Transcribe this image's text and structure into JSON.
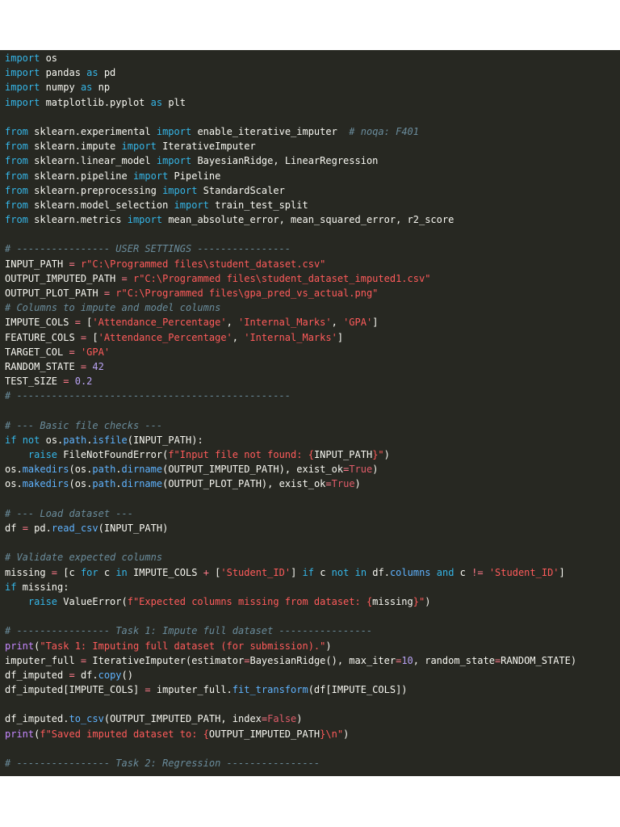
{
  "code_lines": [
    [
      {
        "t": "import",
        "c": "kw"
      },
      {
        "t": " os"
      }
    ],
    [
      {
        "t": "import",
        "c": "kw"
      },
      {
        "t": " pandas "
      },
      {
        "t": "as",
        "c": "kw"
      },
      {
        "t": " pd"
      }
    ],
    [
      {
        "t": "import",
        "c": "kw"
      },
      {
        "t": " numpy "
      },
      {
        "t": "as",
        "c": "kw"
      },
      {
        "t": " np"
      }
    ],
    [
      {
        "t": "import",
        "c": "kw"
      },
      {
        "t": " matplotlib.pyplot "
      },
      {
        "t": "as",
        "c": "kw"
      },
      {
        "t": " plt"
      }
    ],
    [],
    [
      {
        "t": "from",
        "c": "kw"
      },
      {
        "t": " sklearn.experimental "
      },
      {
        "t": "import",
        "c": "kw"
      },
      {
        "t": " enable_iterative_imputer  "
      },
      {
        "t": "# noqa: F401",
        "c": "cmt"
      }
    ],
    [
      {
        "t": "from",
        "c": "kw"
      },
      {
        "t": " sklearn.impute "
      },
      {
        "t": "import",
        "c": "kw"
      },
      {
        "t": " IterativeImputer"
      }
    ],
    [
      {
        "t": "from",
        "c": "kw"
      },
      {
        "t": " sklearn.linear_model "
      },
      {
        "t": "import",
        "c": "kw"
      },
      {
        "t": " BayesianRidge, LinearRegression"
      }
    ],
    [
      {
        "t": "from",
        "c": "kw"
      },
      {
        "t": " sklearn.pipeline "
      },
      {
        "t": "import",
        "c": "kw"
      },
      {
        "t": " Pipeline"
      }
    ],
    [
      {
        "t": "from",
        "c": "kw"
      },
      {
        "t": " sklearn.preprocessing "
      },
      {
        "t": "import",
        "c": "kw"
      },
      {
        "t": " StandardScaler"
      }
    ],
    [
      {
        "t": "from",
        "c": "kw"
      },
      {
        "t": " sklearn.model_selection "
      },
      {
        "t": "import",
        "c": "kw"
      },
      {
        "t": " train_test_split"
      }
    ],
    [
      {
        "t": "from",
        "c": "kw"
      },
      {
        "t": " sklearn.metrics "
      },
      {
        "t": "import",
        "c": "kw"
      },
      {
        "t": " mean_absolute_error, mean_squared_error, r2_score"
      }
    ],
    [],
    [
      {
        "t": "# ---------------- USER SETTINGS ----------------",
        "c": "cmt"
      }
    ],
    [
      {
        "t": "INPUT_PATH "
      },
      {
        "t": "=",
        "c": "op"
      },
      {
        "t": " "
      },
      {
        "t": "r\"C:\\Programmed files\\student_dataset.csv\"",
        "c": "str"
      }
    ],
    [
      {
        "t": "OUTPUT_IMPUTED_PATH "
      },
      {
        "t": "=",
        "c": "op"
      },
      {
        "t": " "
      },
      {
        "t": "r\"C:\\Programmed files\\student_dataset_imputed1.csv\"",
        "c": "str"
      }
    ],
    [
      {
        "t": "OUTPUT_PLOT_PATH "
      },
      {
        "t": "=",
        "c": "op"
      },
      {
        "t": " "
      },
      {
        "t": "r\"C:\\Programmed files\\gpa_pred_vs_actual.png\"",
        "c": "str"
      }
    ],
    [
      {
        "t": "# Columns to impute and model columns",
        "c": "cmt"
      }
    ],
    [
      {
        "t": "IMPUTE_COLS "
      },
      {
        "t": "=",
        "c": "op"
      },
      {
        "t": " ["
      },
      {
        "t": "'Attendance_Percentage'",
        "c": "str"
      },
      {
        "t": ", "
      },
      {
        "t": "'Internal_Marks'",
        "c": "str"
      },
      {
        "t": ", "
      },
      {
        "t": "'GPA'",
        "c": "str"
      },
      {
        "t": "]"
      }
    ],
    [
      {
        "t": "FEATURE_COLS "
      },
      {
        "t": "=",
        "c": "op"
      },
      {
        "t": " ["
      },
      {
        "t": "'Attendance_Percentage'",
        "c": "str"
      },
      {
        "t": ", "
      },
      {
        "t": "'Internal_Marks'",
        "c": "str"
      },
      {
        "t": "]"
      }
    ],
    [
      {
        "t": "TARGET_COL "
      },
      {
        "t": "=",
        "c": "op"
      },
      {
        "t": " "
      },
      {
        "t": "'GPA'",
        "c": "str"
      }
    ],
    [
      {
        "t": "RANDOM_STATE "
      },
      {
        "t": "=",
        "c": "op"
      },
      {
        "t": " "
      },
      {
        "t": "42",
        "c": "num"
      }
    ],
    [
      {
        "t": "TEST_SIZE "
      },
      {
        "t": "=",
        "c": "op"
      },
      {
        "t": " "
      },
      {
        "t": "0.2",
        "c": "num"
      }
    ],
    [
      {
        "t": "# -----------------------------------------------",
        "c": "cmt"
      }
    ],
    [],
    [
      {
        "t": "# --- Basic file checks ---",
        "c": "cmt"
      }
    ],
    [
      {
        "t": "if",
        "c": "kw"
      },
      {
        "t": " "
      },
      {
        "t": "not",
        "c": "kw"
      },
      {
        "t": " os."
      },
      {
        "t": "path",
        "c": "fn"
      },
      {
        "t": "."
      },
      {
        "t": "isfile",
        "c": "fn"
      },
      {
        "t": "(INPUT_PATH):"
      }
    ],
    [
      {
        "t": "    "
      },
      {
        "t": "raise",
        "c": "kw"
      },
      {
        "t": " FileNotFoundError("
      },
      {
        "t": "f\"Input file not found: {",
        "c": "str"
      },
      {
        "t": "INPUT_PATH"
      },
      {
        "t": "}\"",
        "c": "str"
      },
      {
        "t": ")"
      }
    ],
    [
      {
        "t": "os."
      },
      {
        "t": "makedirs",
        "c": "fn"
      },
      {
        "t": "(os."
      },
      {
        "t": "path",
        "c": "fn"
      },
      {
        "t": "."
      },
      {
        "t": "dirname",
        "c": "fn"
      },
      {
        "t": "(OUTPUT_IMPUTED_PATH), exist_ok"
      },
      {
        "t": "=",
        "c": "op"
      },
      {
        "t": "True",
        "c": "cst"
      },
      {
        "t": ")"
      }
    ],
    [
      {
        "t": "os."
      },
      {
        "t": "makedirs",
        "c": "fn"
      },
      {
        "t": "(os."
      },
      {
        "t": "path",
        "c": "fn"
      },
      {
        "t": "."
      },
      {
        "t": "dirname",
        "c": "fn"
      },
      {
        "t": "(OUTPUT_PLOT_PATH), exist_ok"
      },
      {
        "t": "=",
        "c": "op"
      },
      {
        "t": "True",
        "c": "cst"
      },
      {
        "t": ")"
      }
    ],
    [],
    [
      {
        "t": "# --- Load dataset ---",
        "c": "cmt"
      }
    ],
    [
      {
        "t": "df "
      },
      {
        "t": "=",
        "c": "op"
      },
      {
        "t": " pd."
      },
      {
        "t": "read_csv",
        "c": "fn"
      },
      {
        "t": "(INPUT_PATH)"
      }
    ],
    [],
    [
      {
        "t": "# Validate expected columns",
        "c": "cmt"
      }
    ],
    [
      {
        "t": "missing "
      },
      {
        "t": "=",
        "c": "op"
      },
      {
        "t": " [c "
      },
      {
        "t": "for",
        "c": "kw"
      },
      {
        "t": " c "
      },
      {
        "t": "in",
        "c": "kw"
      },
      {
        "t": " IMPUTE_COLS "
      },
      {
        "t": "+",
        "c": "op"
      },
      {
        "t": " ["
      },
      {
        "t": "'Student_ID'",
        "c": "str"
      },
      {
        "t": "] "
      },
      {
        "t": "if",
        "c": "kw"
      },
      {
        "t": " c "
      },
      {
        "t": "not",
        "c": "kw"
      },
      {
        "t": " "
      },
      {
        "t": "in",
        "c": "kw"
      },
      {
        "t": " df."
      },
      {
        "t": "columns",
        "c": "fn"
      },
      {
        "t": " "
      },
      {
        "t": "and",
        "c": "kw"
      },
      {
        "t": " c "
      },
      {
        "t": "!=",
        "c": "op"
      },
      {
        "t": " "
      },
      {
        "t": "'Student_ID'",
        "c": "str"
      },
      {
        "t": "]"
      }
    ],
    [
      {
        "t": "if",
        "c": "kw"
      },
      {
        "t": " missing:"
      }
    ],
    [
      {
        "t": "    "
      },
      {
        "t": "raise",
        "c": "kw"
      },
      {
        "t": " ValueError("
      },
      {
        "t": "f\"Expected columns missing from dataset: {",
        "c": "str"
      },
      {
        "t": "missing"
      },
      {
        "t": "}\"",
        "c": "str"
      },
      {
        "t": ")"
      }
    ],
    [],
    [
      {
        "t": "# ---------------- Task 1: Impute full dataset ----------------",
        "c": "cmt"
      }
    ],
    [
      {
        "t": "print",
        "c": "bi"
      },
      {
        "t": "("
      },
      {
        "t": "\"Task 1: Imputing full dataset (for submission).\"",
        "c": "str"
      },
      {
        "t": ")"
      }
    ],
    [
      {
        "t": "imputer_full "
      },
      {
        "t": "=",
        "c": "op"
      },
      {
        "t": " IterativeImputer(estimator"
      },
      {
        "t": "=",
        "c": "op"
      },
      {
        "t": "BayesianRidge(), max_iter"
      },
      {
        "t": "=",
        "c": "op"
      },
      {
        "t": "10",
        "c": "num"
      },
      {
        "t": ", random_state"
      },
      {
        "t": "=",
        "c": "op"
      },
      {
        "t": "RANDOM_STATE)"
      }
    ],
    [
      {
        "t": "df_imputed "
      },
      {
        "t": "=",
        "c": "op"
      },
      {
        "t": " df."
      },
      {
        "t": "copy",
        "c": "fn"
      },
      {
        "t": "()"
      }
    ],
    [
      {
        "t": "df_imputed[IMPUTE_COLS] "
      },
      {
        "t": "=",
        "c": "op"
      },
      {
        "t": " imputer_full."
      },
      {
        "t": "fit_transform",
        "c": "fn"
      },
      {
        "t": "(df[IMPUTE_COLS])"
      }
    ],
    [],
    [
      {
        "t": "df_imputed."
      },
      {
        "t": "to_csv",
        "c": "fn"
      },
      {
        "t": "(OUTPUT_IMPUTED_PATH, index"
      },
      {
        "t": "=",
        "c": "op"
      },
      {
        "t": "False",
        "c": "cst"
      },
      {
        "t": ")"
      }
    ],
    [
      {
        "t": "print",
        "c": "bi"
      },
      {
        "t": "("
      },
      {
        "t": "f\"Saved imputed dataset to: {",
        "c": "str"
      },
      {
        "t": "OUTPUT_IMPUTED_PATH"
      },
      {
        "t": "}\\n\"",
        "c": "str"
      },
      {
        "t": ")"
      }
    ],
    [],
    [
      {
        "t": "# ---------------- Task 2: Regression ----------------",
        "c": "cmt"
      }
    ]
  ]
}
